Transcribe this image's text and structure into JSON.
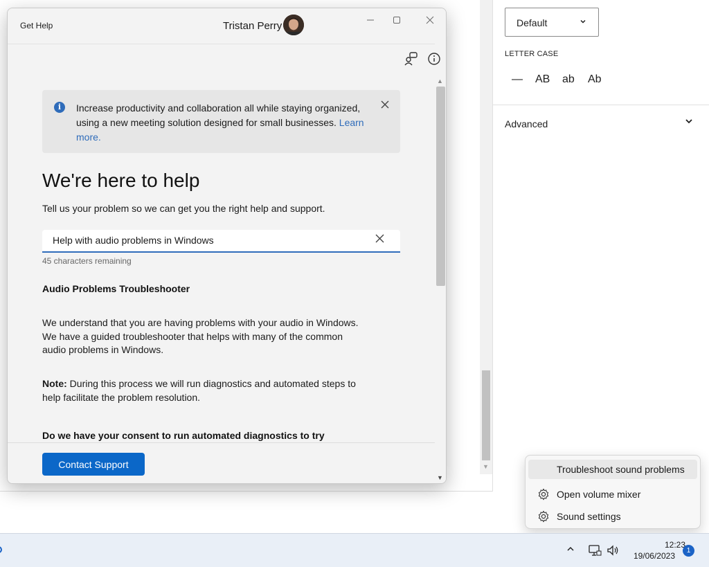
{
  "background_editor": {
    "font_select_value": "Default",
    "letter_case_label": "LETTER CASE",
    "letter_case_options": [
      "—",
      "AB",
      "ab",
      "Ab"
    ],
    "advanced_label": "Advanced"
  },
  "window": {
    "app_title": "Get Help",
    "user_name": "Tristan Perry",
    "banner": {
      "text": "Increase productivity and collaboration all while staying organized, using a new meeting solution designed for small businesses.",
      "link_text": "Learn more."
    },
    "heading": "We're here to help",
    "subheading": "Tell us your problem so we can get you the right help and support.",
    "search": {
      "value": "Help with audio problems in Windows",
      "char_count": "45 characters remaining"
    },
    "section_title": "Audio Problems Troubleshooter",
    "paragraph_1": "We understand that you are having problems with your audio in Windows. We have a guided troubleshooter that helps with many of the common audio problems in Windows.",
    "note_label": "Note:",
    "note_text": "During this process we will run diagnostics and automated steps to help facilitate the problem resolution.",
    "consent_text": "Do we have your consent to run automated diagnostics to try",
    "contact_button": "Contact Support"
  },
  "context_menu": {
    "items": [
      {
        "label": "Troubleshoot sound problems",
        "icon": "none"
      },
      {
        "label": "Open volume mixer",
        "icon": "gear-icon"
      },
      {
        "label": "Sound settings",
        "icon": "gear-icon"
      }
    ]
  },
  "taskbar": {
    "time": "12:23",
    "date": "19/06/2023",
    "notification_count": "1"
  },
  "colors": {
    "accent": "#0b67c8",
    "link": "#2f6cba",
    "taskbar": "#e9eff7"
  }
}
